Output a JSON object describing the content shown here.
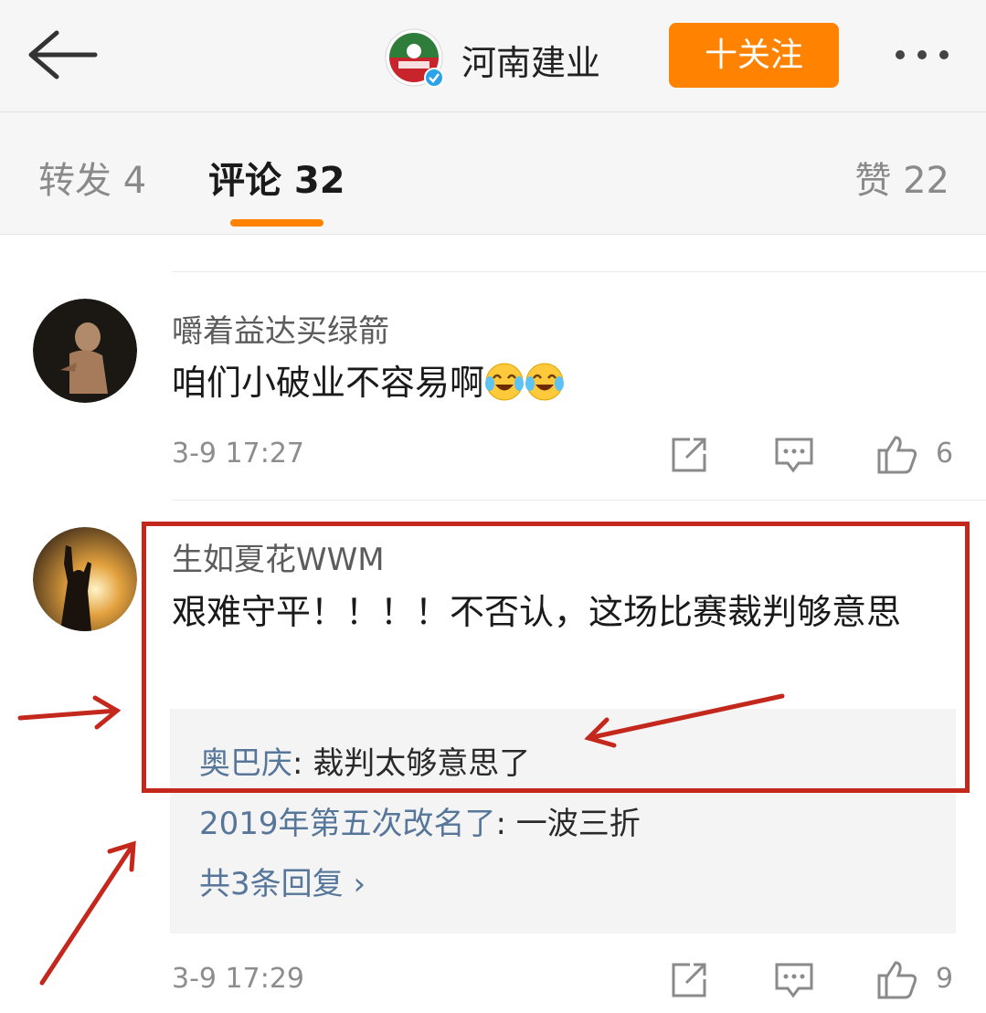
{
  "header": {
    "back_icon": "arrow-left-icon",
    "account_name": "河南建业",
    "follow_label": "十关注",
    "more_icon": "more-dots-icon",
    "accent_color": "#ff8200"
  },
  "tabs": {
    "repost": "转发 4",
    "comments": "评论 32",
    "likes": "赞 22"
  },
  "comments": [
    {
      "username": "嚼着益达买绿箭",
      "content": "咱们小破业不容易啊",
      "emojis": [
        "laugh-cry-emoji",
        "laugh-cry-emoji"
      ],
      "time": "3-9 17:27",
      "likes": "6"
    },
    {
      "username": "生如夏花WWM",
      "content": "艰难守平！！！！不否认，这场比赛裁判够意思",
      "time": "3-9 17:29",
      "likes": "9",
      "replies": [
        {
          "name": "奥巴庆",
          "text": ": 裁判太够意思了"
        },
        {
          "name": "2019年第五次改名了",
          "text": ": 一波三折"
        }
      ],
      "replies_total": "共3条回复 ›"
    }
  ],
  "annotation_color": "#c4281c"
}
